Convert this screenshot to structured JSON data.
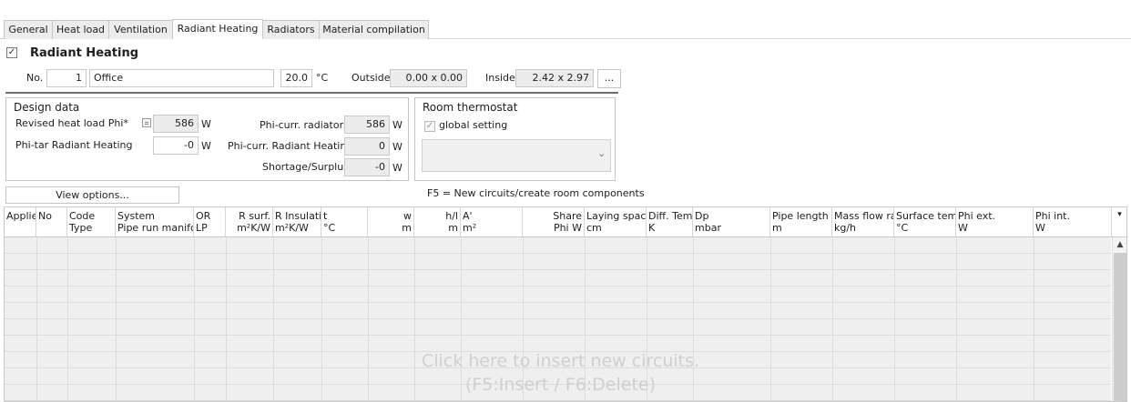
{
  "tabs": [
    "General",
    "Heat load",
    "Ventilation",
    "Radiant Heating",
    "Radiators",
    "Material compilation"
  ],
  "active_tab": "Radiant Heating",
  "header": {
    "enabled_check": "✓",
    "title": "Radiant Heating",
    "no_label": "No.",
    "no_value": "1",
    "room_name": "Office",
    "temperature": "20.0",
    "temperature_unit": "°C",
    "outside_label": "Outside",
    "outside_value": "0.00 x 0.00",
    "inside_label": "Inside",
    "inside_value": "2.42 x 2.97",
    "more_button": "..."
  },
  "design": {
    "title": "Design data",
    "revised_label": "Revised heat load Phi*",
    "revised_value": "586",
    "revised_unit": "W",
    "phitar_label": "Phi-tar Radiant Heating",
    "phitar_value": "-0",
    "phitar_unit": "W",
    "phicurr_rad_label": "Phi-curr. radiators",
    "phicurr_rad_value": "586",
    "phicurr_rad_unit": "W",
    "phicurr_rh_label": "Phi-curr. Radiant Heating",
    "phicurr_rh_value": "0",
    "phicurr_rh_unit": "W",
    "shortage_label": "Shortage/Surplus",
    "shortage_value": "-0",
    "shortage_unit": "W"
  },
  "thermostat": {
    "title": "Room thermostat",
    "global_check": "✓",
    "global_label": "global setting",
    "combo_value": "",
    "combo_arrow": "⌄"
  },
  "toolbar": {
    "view_options": "View options...",
    "hint": "F5 = New circuits/create room components"
  },
  "grid": {
    "columns": [
      {
        "l1": "Applied",
        "l2": ""
      },
      {
        "l1": "No",
        "l2": ""
      },
      {
        "l1": "Code",
        "l2": "Type"
      },
      {
        "l1": "System",
        "l2": "Pipe run manifold"
      },
      {
        "l1": "OR",
        "l2": "LP"
      },
      {
        "l1": "R surf.",
        "l2": "m²K/W"
      },
      {
        "l1": "R Insulation",
        "l2": "m²K/W"
      },
      {
        "l1": "t",
        "l2": "°C"
      },
      {
        "l1": "w",
        "l2": "m"
      },
      {
        "l1": "h/l",
        "l2": "m"
      },
      {
        "l1": "A'",
        "l2": "m²"
      },
      {
        "l1": "Share",
        "l2": "Phi W"
      },
      {
        "l1": "Laying spacing",
        "l2": "cm"
      },
      {
        "l1": "Diff. Temp",
        "l2": "K"
      },
      {
        "l1": "Dp",
        "l2": "mbar"
      },
      {
        "l1": "Pipe length",
        "l2": "m"
      },
      {
        "l1": "Mass flow rate",
        "l2": "kg/h"
      },
      {
        "l1": "Surface temp",
        "l2": "°C"
      },
      {
        "l1": "Phi ext.",
        "l2": "W"
      },
      {
        "l1": "Phi int.",
        "l2": "W"
      }
    ],
    "column_menu": "▾",
    "scroll_up": "▲",
    "empty_line1": "Click here to insert new circuits.",
    "empty_line2": "(F5:Insert / F6:Delete)"
  }
}
